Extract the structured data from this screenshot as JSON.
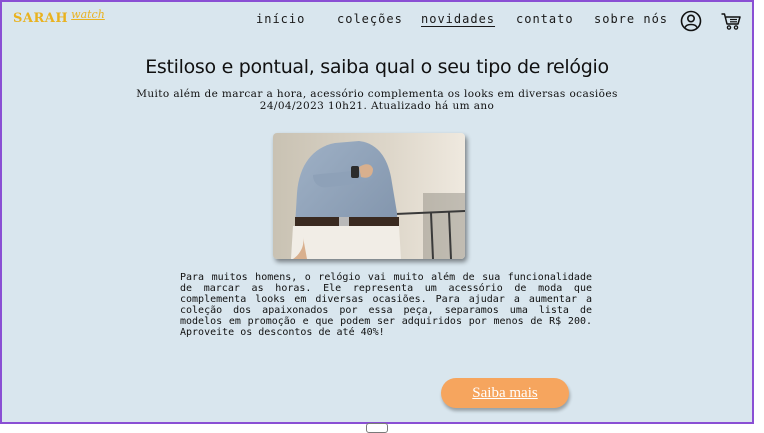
{
  "brand": {
    "name": "SARAH",
    "script": "watch"
  },
  "nav": {
    "items": [
      {
        "label": "início",
        "active": false
      },
      {
        "label": "coleções",
        "active": false
      },
      {
        "label": "novidades",
        "active": true
      },
      {
        "label": "contato",
        "active": false
      },
      {
        "label": "sobre nós",
        "active": false
      }
    ],
    "icons": [
      "user-icon",
      "cart-icon"
    ]
  },
  "article": {
    "title": "Estiloso e pontual, saiba qual o seu tipo de relógio",
    "subtitle": "Muito além de marcar a hora, acessório complementa os looks em diversas ocasiões",
    "meta": "24/04/2023 10h21. Atualizado há um ano",
    "body": "Para muitos homens, o relógio vai muito além de sua funcionalidade de marcar as horas. Ele representa um acessório de moda que complementa looks em diversas ocasiões. Para ajudar a aumentar a coleção dos apaixonados por essa peça, separamos uma lista de modelos em promoção e que podem ser adquiridos por menos de R$ 200. Aproveite os descontos de até 40%!",
    "cta_label": "Saiba mais"
  },
  "colors": {
    "background": "#d9e6ee",
    "frame_border": "#8a4fd4",
    "brand": "#e9b21f",
    "cta": "#f6a55e"
  }
}
